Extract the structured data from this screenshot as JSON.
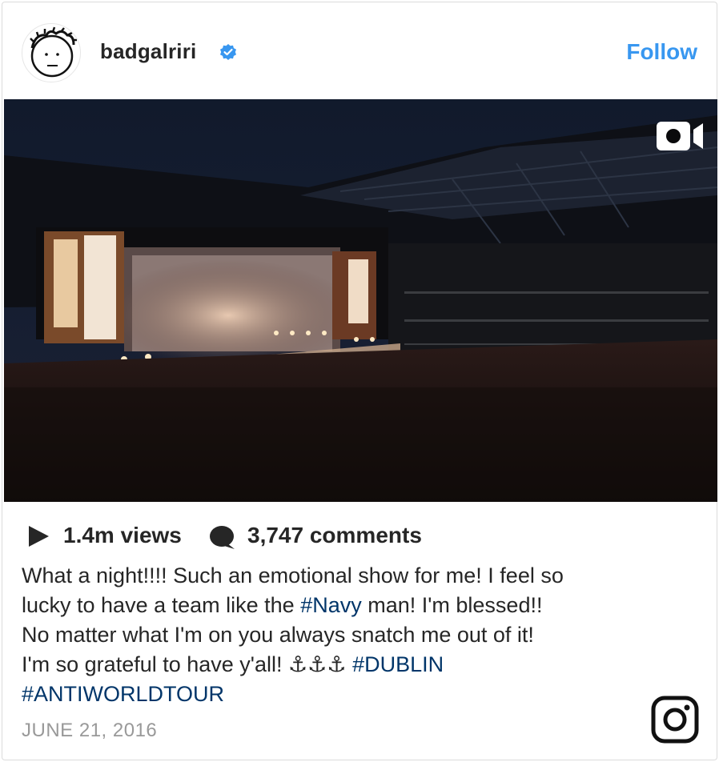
{
  "post": {
    "username": "badgalriri",
    "follow_label": "Follow",
    "views": "1.4m views",
    "comments": "3,747 comments",
    "caption": {
      "line1": "What a night!!!! Such an emotional show for me! I feel so",
      "line2_pre": "lucky to have a team like the ",
      "line2_tag": "#Navy",
      "line2_post": " man! I'm blessed!!",
      "line3": "No matter what I'm on you always snatch me out of it!",
      "line4_pre": "I'm so grateful to have y'all! ⚓⚓⚓ ",
      "line4_tag": "#DUBLIN",
      "line5_tag": "#ANTIWORLDTOUR"
    },
    "date": "JUNE 21, 2016"
  },
  "icons": {
    "verified": "verified-badge-icon",
    "video": "video-camera-icon",
    "play": "play-icon",
    "comment": "comment-bubble-icon",
    "instagram": "instagram-logo-icon"
  },
  "colors": {
    "follow": "#3897f0",
    "hashtag": "#003569",
    "date": "#999999",
    "verified": "#3897f0"
  }
}
